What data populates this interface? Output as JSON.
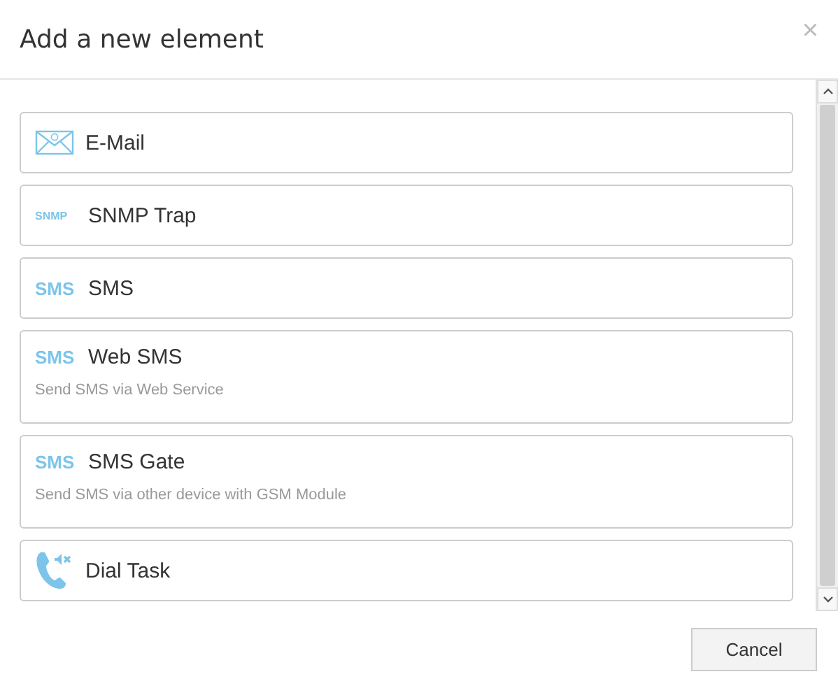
{
  "dialog": {
    "title": "Add a new element",
    "close": "×"
  },
  "elements": [
    {
      "kind": "mail",
      "label": "E-Mail"
    },
    {
      "kind": "text",
      "badge": "SNMP",
      "label": "SNMP Trap"
    },
    {
      "kind": "text",
      "badge": "SMS",
      "label": "SMS"
    },
    {
      "kind": "text",
      "badge": "SMS",
      "label": "Web SMS",
      "description": "Send SMS via Web Service"
    },
    {
      "kind": "text",
      "badge": "SMS",
      "label": "SMS Gate",
      "description": "Send SMS via other device with GSM Module"
    },
    {
      "kind": "phone",
      "label": "Dial Task"
    }
  ],
  "buttons": [
    "Cancel"
  ]
}
